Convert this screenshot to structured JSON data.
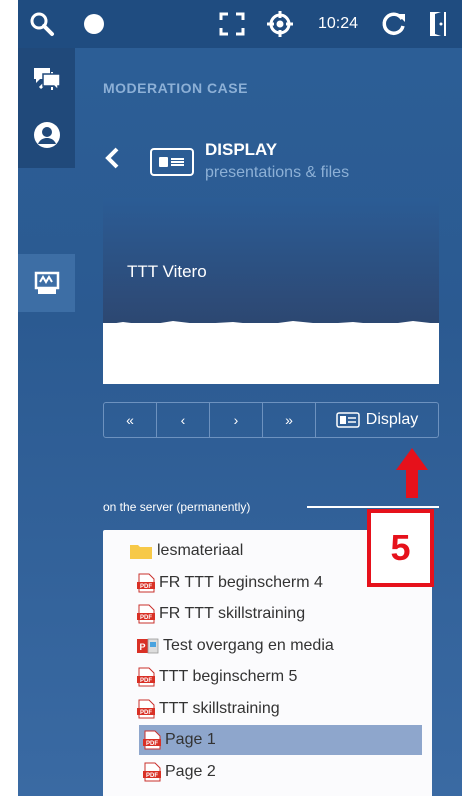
{
  "topbar": {
    "time": "10:24",
    "icons": [
      "search-icon",
      "record-dot-icon",
      "fullscreen-icon",
      "target-icon",
      "refresh-icon",
      "exit-door-icon"
    ]
  },
  "rail": {
    "icons": [
      "collapse-panel-icon",
      "chat-icon",
      "user-icon",
      "whiteboard-icon"
    ]
  },
  "panel": {
    "case_title": "MODERATION CASE",
    "section_title": "DISPLAY",
    "section_subtitle": "presentations & files"
  },
  "slide": {
    "title": "TTT Vitero"
  },
  "nav": {
    "first_label": "«",
    "prev_label": "‹",
    "next_label": "›",
    "last_label": "»",
    "display_label": "Display"
  },
  "server_label": "on the server (permanently)",
  "files": [
    {
      "label": "lesmateriaal",
      "type": "folder",
      "indent": 1,
      "selected": false
    },
    {
      "label": "FR TTT beginscherm 4",
      "type": "pdf",
      "indent": 2,
      "selected": false
    },
    {
      "label": "FR TTT skillstraining",
      "type": "pdf",
      "indent": 2,
      "selected": false
    },
    {
      "label": "Test overgang en media",
      "type": "ppt",
      "indent": 2,
      "selected": false
    },
    {
      "label": "TTT beginscherm 5",
      "type": "pdf",
      "indent": 2,
      "selected": false
    },
    {
      "label": "TTT skillstraining",
      "type": "pdf",
      "indent": 2,
      "selected": false
    },
    {
      "label": "Page 1",
      "type": "pdf",
      "indent": 3,
      "selected": true
    },
    {
      "label": "Page 2",
      "type": "pdf",
      "indent": 3,
      "selected": false
    }
  ],
  "annotation": {
    "number": "5",
    "color": "#e6111b"
  },
  "colors": {
    "topbar": "#1f4c80",
    "panel_bg": "#2c5f97",
    "muted_text": "#8db0d6",
    "selected_row": "#8ea6cc",
    "pdf_red": "#d93025"
  }
}
